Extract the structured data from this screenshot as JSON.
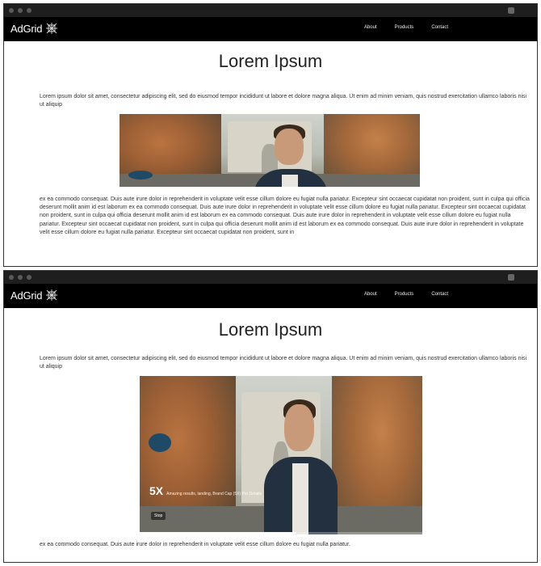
{
  "brand": {
    "name": "AdGrid"
  },
  "nav": {
    "items": [
      "About",
      "Products",
      "Contact"
    ]
  },
  "page": {
    "title": "Lorem Ipsum",
    "intro": "Lorem ipsum dolor sit amet, consectetur adipiscing elit, sed do eiusmod tempor incididunt ut labore et dolore magna aliqua. Ut enim ad minim veniam, quis nostrud exercitation ullamco laboris nisi ut aliquip",
    "body": "ex ea commodo consequat. Duis aute irure dolor in reprehenderit in voluptate velit esse cillum dolore eu fugiat nulla pariatur. Excepteur sint occaecat cupidatat non proident, sunt in culpa qui officia deserunt mollit anim id est laborum ex ea commodo consequat. Duis aute irure dolor in reprehenderit in voluptate velit esse cillum dolore eu fugiat nulla pariatur. Excepteur sint occaecat cupidatat non proident, sunt in culpa qui officia deserunt mollit anim id est laborum ex ea commodo consequat. Duis aute irure dolor in reprehenderit in voluptate velit esse cillum dolore eu fugiat nulla pariatur. Excepteur sint occaecat cupidatat non proident, sunt in culpa qui officia deserunt mollit anim id est laborum ex ea commodo consequat. Duis aute irure dolor in reprehenderit in voluptate velit esse cillum dolore eu fugiat nulla pariatur. Excepteur sint occaecat cupidatat non proident, sunt in",
    "footer": "ex ea commodo consequat. Duis aute irure dolor in reprehenderit in voluptate velit esse cillum dolore eu fugiat nulla pariatur."
  },
  "video": {
    "multiplier": "5X",
    "caption": "Amazing results, landing, Brand Cap (5X) Pro Details",
    "badge": "Stop",
    "progress": 0.55
  },
  "colors": {
    "navbar": "#000000",
    "chrome": "#1e1e1e",
    "text": "#333333"
  },
  "icons": {
    "logo": "adgrid-logo-icon"
  }
}
